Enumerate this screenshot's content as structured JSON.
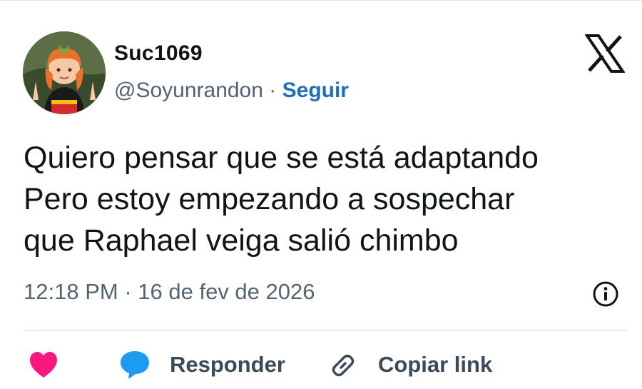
{
  "author": {
    "display_name": "Suc1069",
    "handle": "@Soyunrandon",
    "separator": "·",
    "follow_label": "Seguir"
  },
  "tweet": {
    "text": "Quiero pensar que se está adaptando\nPero estoy empezando a sospechar\nque Raphael veiga salió chimbo",
    "time": "12:18 PM",
    "date_separator": "·",
    "date": "16 de fev de 2026"
  },
  "actions": {
    "like_icon": "heart-icon",
    "reply_icon": "speech-bubble-icon",
    "reply_label": "Responder",
    "copy_icon": "link-icon",
    "copy_label": "Copiar link"
  },
  "colors": {
    "follow": "#1d6fbf",
    "like": "#f91880",
    "reply": "#1d9bf0",
    "text": "#0f1419",
    "secondary": "#536471"
  }
}
